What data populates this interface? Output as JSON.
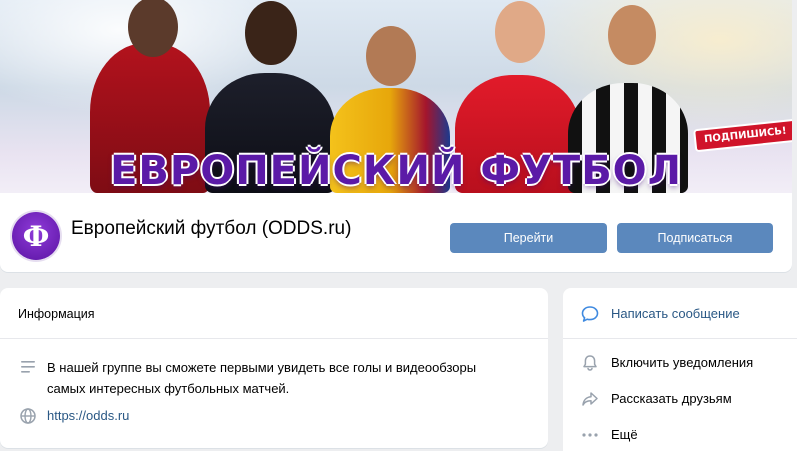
{
  "cover": {
    "title": "ЕВРОПЕЙСКИЙ ФУТБОЛ",
    "badge": "ПОДПИШИСЬ!"
  },
  "group": {
    "avatar_letter": "Ф",
    "name": "Европейский футбол (ODDS.ru)",
    "go_button": "Перейти",
    "subscribe_button": "Подписаться"
  },
  "info": {
    "title": "Информация",
    "description": "В нашей группе вы сможете первыми увидеть все голы и видеообзоры самых интересных футбольных матчей.",
    "link": "https://odds.ru"
  },
  "actions": [
    {
      "label": "Написать сообщение",
      "icon": "message-icon"
    },
    {
      "label": "Включить уведомления",
      "icon": "bell-icon"
    },
    {
      "label": "Рассказать друзьям",
      "icon": "share-icon"
    },
    {
      "label": "Ещё",
      "icon": "more-icon"
    }
  ],
  "colors": {
    "accent": "#5b88bd",
    "link": "#2a5885",
    "background": "#edeef0",
    "title_purple": "#5b1aa7",
    "icon_gray": "#99a2ad",
    "icon_blue": "#3f8ae0"
  }
}
